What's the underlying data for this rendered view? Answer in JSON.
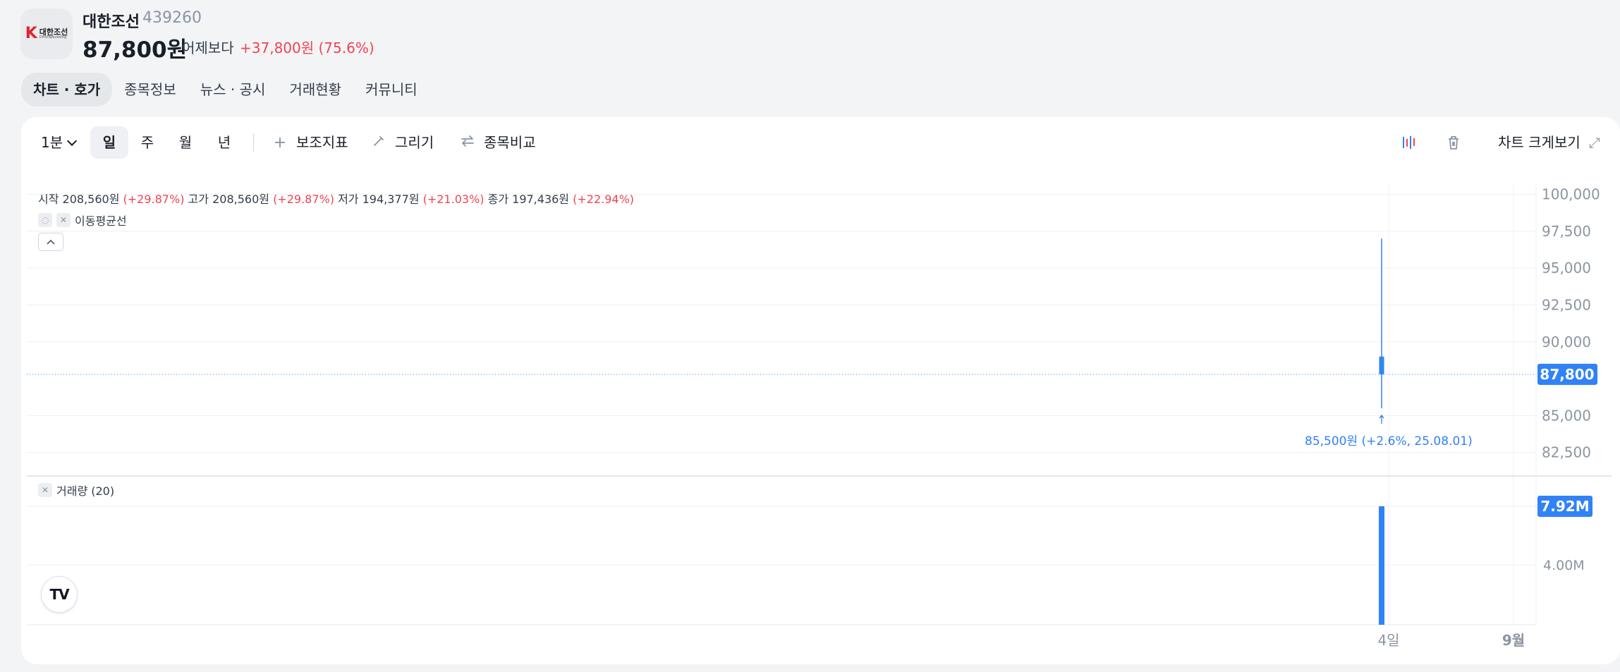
{
  "stock": {
    "name": "대한조선",
    "code": "439260",
    "price": "87,800원",
    "vs_label": "어제보다",
    "change": "+37,800원 (75.6%)",
    "logo_text_ko": "대한조선",
    "logo_text_en": "DHShipbuilding"
  },
  "tabs": [
    "차트 · 호가",
    "종목정보",
    "뉴스 · 공시",
    "거래현황",
    "커뮤니티"
  ],
  "toolbar": {
    "interval": "1분",
    "periods": [
      "일",
      "주",
      "월",
      "년"
    ],
    "active_period": "일",
    "indicator": "보조지표",
    "draw": "그리기",
    "compare": "종목비교",
    "chart_icon": "candlestick-settings-icon",
    "trash_icon": "trash-icon",
    "expand": "차트 크게보기"
  },
  "legend": {
    "open_label": "시작",
    "open": "208,560원",
    "open_chg": "(+29.87%)",
    "high_label": "고가",
    "high": "208,560원",
    "high_chg": "(+29.87%)",
    "low_label": "저가",
    "low": "194,377원",
    "low_chg": "(+21.03%)",
    "close_label": "종가",
    "close": "197,436원",
    "close_chg": "(+22.94%)",
    "ma": "이동평균선",
    "volume": "거래량 (20)"
  },
  "colors": {
    "up": "#f04452",
    "candle": "#3182f6",
    "accent": "#3182f6",
    "text": "#191f28",
    "muted": "#8b95a1"
  },
  "chart_data": {
    "type": "candlestick",
    "price_axis": [
      "100,000",
      "97,500",
      "95,000",
      "92,500",
      "90,000",
      "85,000",
      "82,500"
    ],
    "price_ticks": [
      100000,
      97500,
      95000,
      92500,
      90000,
      85000,
      82500
    ],
    "price_range": [
      81100,
      100600
    ],
    "current_price_label": "87,800",
    "current_price": 87800,
    "candles": [
      {
        "x": "4일",
        "open": 87800,
        "high": 97000,
        "low": 85500,
        "close": 89000
      }
    ],
    "low_annotation": "85,500원 (+2.6%, 25.08.01)",
    "volume_axis": [
      "4.00M"
    ],
    "volume_ticks": [
      4000000
    ],
    "volume_range": [
      0,
      9900000
    ],
    "volume_label": "7.92M",
    "volume": [
      7920000
    ],
    "x_ticks": [
      "4일",
      "9월"
    ]
  }
}
